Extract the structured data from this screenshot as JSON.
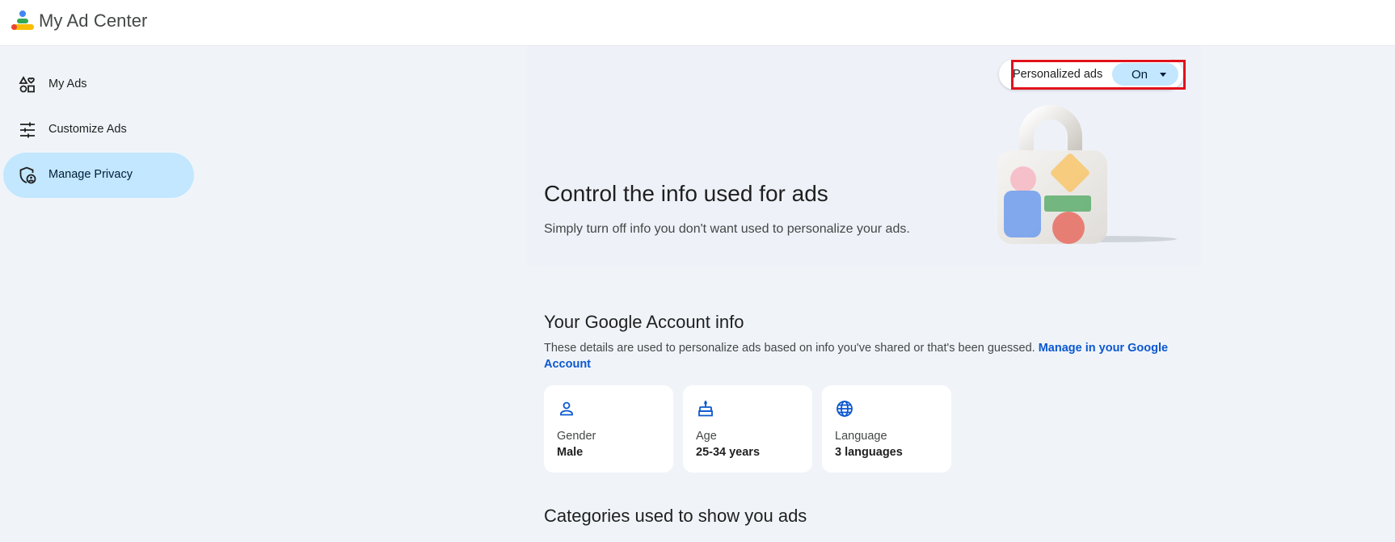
{
  "app": {
    "title": "My Ad Center"
  },
  "sidebar": {
    "items": [
      {
        "label": "My Ads",
        "icon": "my-ads-icon",
        "active": false
      },
      {
        "label": "Customize Ads",
        "icon": "tune-icon",
        "active": false
      },
      {
        "label": "Manage Privacy",
        "icon": "privacy-shield-icon",
        "active": true
      }
    ]
  },
  "personalized_ads": {
    "label": "Personalized ads",
    "value": "On"
  },
  "hero": {
    "title": "Control the info used for ads",
    "subtitle": "Simply turn off info you don't want used to personalize your ads."
  },
  "account_info": {
    "title": "Your Google Account info",
    "description": "These details are used to personalize ads based on info you've shared or that's been guessed. ",
    "link": "Manage in your Google Account",
    "cards": [
      {
        "label": "Gender",
        "value": "Male",
        "icon": "person-icon"
      },
      {
        "label": "Age",
        "value": "25-34 years",
        "icon": "cake-icon"
      },
      {
        "label": "Language",
        "value": "3 languages",
        "icon": "globe-icon"
      }
    ]
  },
  "categories": {
    "title": "Categories used to show you ads"
  },
  "colors": {
    "accent": "#0b57d0",
    "active_bg": "#c2e7ff",
    "page_bg": "#f0f4f9",
    "highlight": "#e0121b"
  }
}
